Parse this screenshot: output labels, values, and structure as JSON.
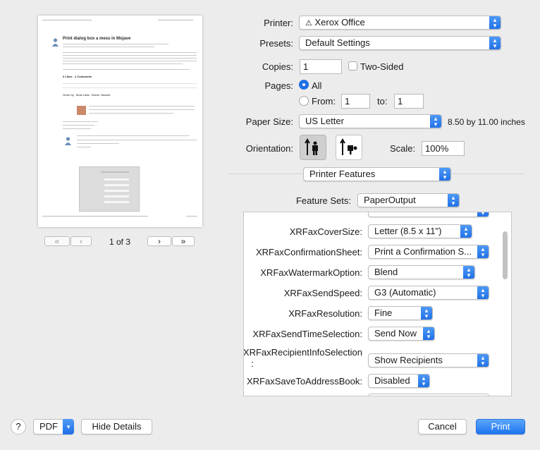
{
  "printer": {
    "label": "Printer:",
    "value": "Xerox Office"
  },
  "presets": {
    "label": "Presets:",
    "value": "Default Settings"
  },
  "copies": {
    "label": "Copies:",
    "value": "1",
    "two_sided_label": "Two-Sided"
  },
  "pages": {
    "label": "Pages:",
    "all_label": "All",
    "from_label": "From:",
    "from_value": "1",
    "to_label": "to:",
    "to_value": "1"
  },
  "paper_size": {
    "label": "Paper Size:",
    "value": "US Letter",
    "dimensions": "8.50 by 11.00 inches"
  },
  "orientation": {
    "label": "Orientation:"
  },
  "scale": {
    "label": "Scale:",
    "value": "100%"
  },
  "section_popup": {
    "value": "Printer Features"
  },
  "feature_sets": {
    "label": "Feature Sets:",
    "value": "PaperOutput"
  },
  "features": [
    {
      "label": "XRFaxCoverSize:",
      "value": "Letter (8.5 x 11\")"
    },
    {
      "label": "XRFaxConfirmationSheet:",
      "value": "Print a Confirmation S..."
    },
    {
      "label": "XRFaxWatermarkOption:",
      "value": "Blend"
    },
    {
      "label": "XRFaxSendSpeed:",
      "value": "G3 (Automatic)"
    },
    {
      "label": "XRFaxResolution:",
      "value": "Fine"
    },
    {
      "label": "XRFaxSendTimeSelection:",
      "value": "Send Now"
    },
    {
      "label": "XRFaxRecipientInfoSelection",
      "label_suffix": ":",
      "value": "Show Recipients"
    },
    {
      "label": "XRFaxSaveToAddressBook:",
      "value": "Disabled"
    }
  ],
  "preview": {
    "title": "Print dialog box a mess in Mojave",
    "page_indicator": "1 of 3",
    "tabs": [
      "Order by:",
      "Most Likes",
      "Oldest",
      "Newest"
    ],
    "likes": "0 Likes",
    "comments": "2 Comments"
  },
  "bottom": {
    "help": "?",
    "pdf": "PDF",
    "hide_details": "Hide Details",
    "cancel": "Cancel",
    "print": "Print"
  },
  "colors": {
    "accent": "#1f6fe6",
    "background": "#ececec"
  }
}
